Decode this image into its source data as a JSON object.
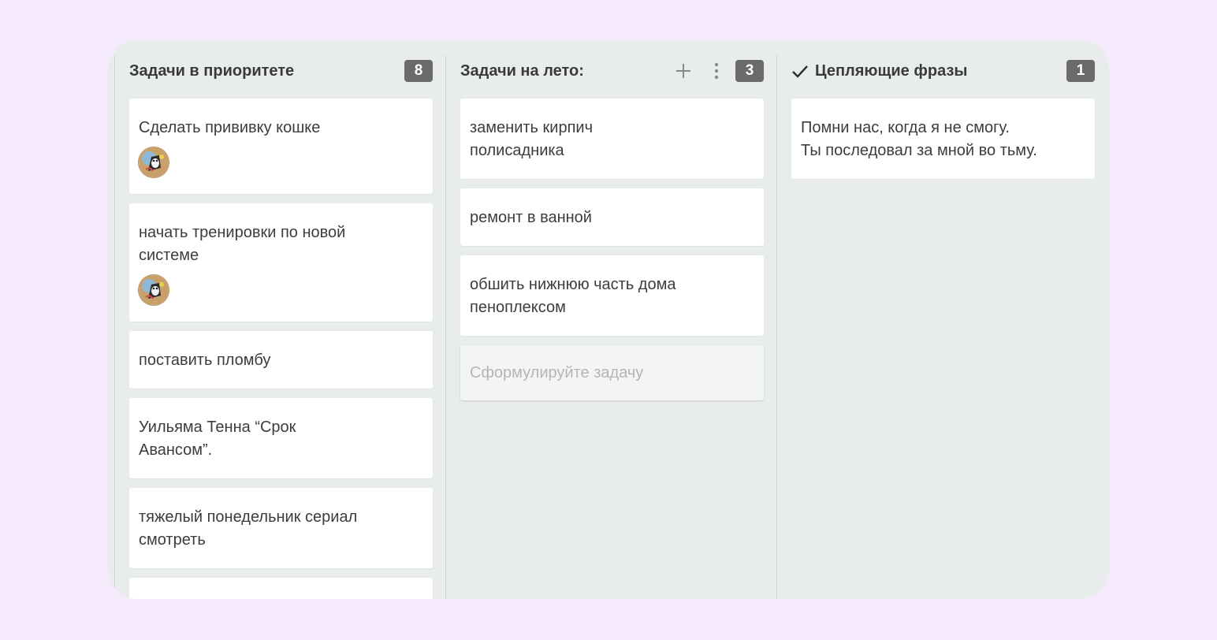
{
  "columns": [
    {
      "title": "Задачи в приоритете",
      "count": "8",
      "cards": [
        {
          "text": "Сделать прививку кошке",
          "avatar": "cat-avatar"
        },
        {
          "text": "начать тренировки по новой\nсистеме",
          "avatar": "cat-avatar"
        },
        {
          "text": "поставить пломбу"
        },
        {
          "text": "Уильяма Тенна “Срок\nАвансом”."
        },
        {
          "text": "тяжелый понедельник сериал\nсмотреть"
        }
      ]
    },
    {
      "title": "Задачи на лето:",
      "count": "3",
      "add_icon": "plus-icon",
      "menu_icon": "more-vertical-icon",
      "cards": [
        {
          "text": "заменить кирпич\nполисадника"
        },
        {
          "text": "ремонт в ванной"
        },
        {
          "text": "обшить нижнюю часть дома\nпеноплексом"
        }
      ],
      "new_card_placeholder": "Сформулируйте задачу"
    },
    {
      "title": "Цепляющие фразы",
      "title_icon": "checkmark-icon",
      "count": "1",
      "cards": [
        {
          "text": "Помни нас, когда я не смогу.\nТы последовал за мной во тьму."
        }
      ]
    }
  ],
  "colors": {
    "page_bg": "#f4eafc",
    "board_bg": "#e9eced",
    "badge_bg": "#6a6a6a"
  }
}
